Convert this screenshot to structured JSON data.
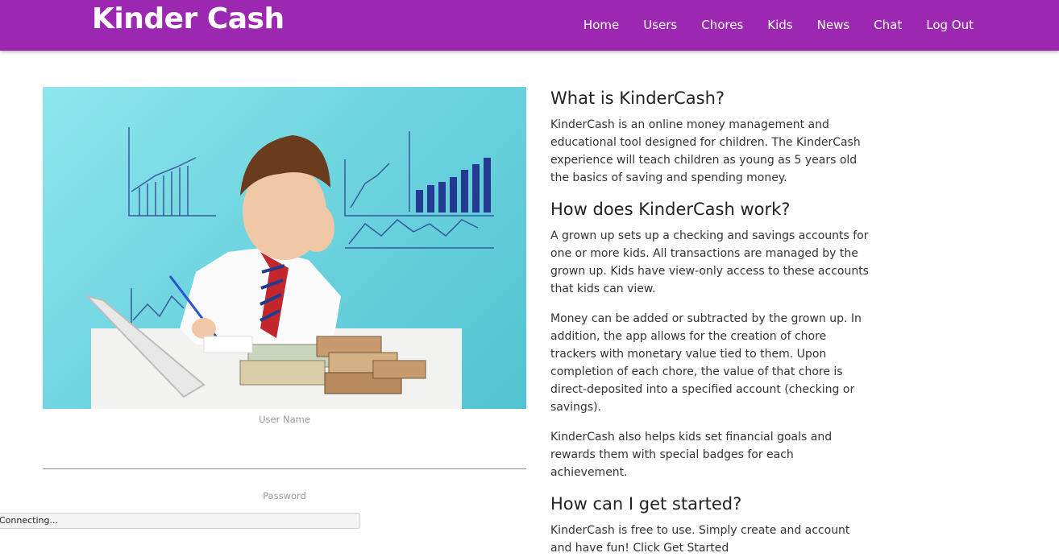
{
  "nav": {
    "brand": "Kinder Cash",
    "links": [
      "Home",
      "Users",
      "Chores",
      "Kids",
      "News",
      "Chat",
      "Log Out"
    ]
  },
  "login": {
    "username_label": "User Name",
    "password_label": "Password"
  },
  "status": "Connecting...",
  "content": {
    "h1": "What is KinderCash?",
    "p1": "KinderCash is an online money management and educational tool designed for children. The KinderCash experience will teach children as young as 5 years old the basics of saving and spending money.",
    "h2": "How does KinderCash work?",
    "p2": "A grown up sets up a checking and savings accounts for one or more kids. All transactions are managed by the grown up. Kids have view-only access to these accounts that kids can view.",
    "p3": "Money can be added or subtracted by the grown up. In addition, the app allows for the creation of chore trackers with monetary value tied to them. Upon completion of each chore, the value of that chore is direct-deposited into a specified account (checking or savings).",
    "p4": "KinderCash also helps kids set financial goals and rewards them with special badges for each achievement.",
    "h3": "How can I get started?",
    "p5": "KinderCash is free to use. Simply create and account and have fun! Click Get Started"
  },
  "colors": {
    "navbar": "#9c27b0"
  }
}
